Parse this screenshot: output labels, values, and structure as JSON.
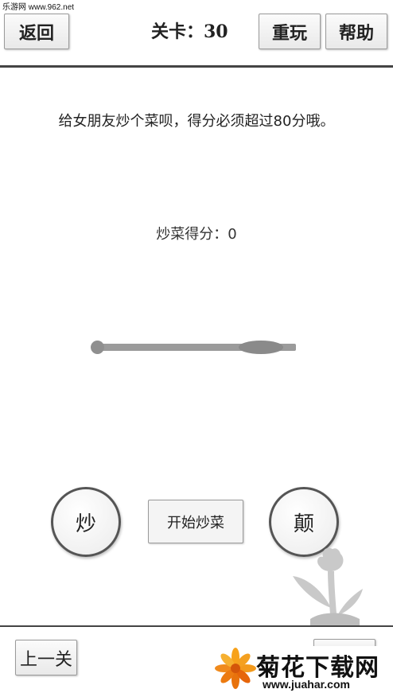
{
  "watermark": {
    "site_text": "乐游网 www.962.net"
  },
  "header": {
    "back_label": "返回",
    "level_label": "关卡：30",
    "replay_label": "重玩",
    "help_label": "帮助"
  },
  "game": {
    "instruction": "给女朋友炒个菜呗，得分必须超过80分哦。",
    "score_label": "炒菜得分：",
    "score_value": "0",
    "stir_label": "炒",
    "start_label": "开始炒菜",
    "toss_label": "颠"
  },
  "footer": {
    "prev_label": "上一关"
  },
  "logo": {
    "name": "菊花下载网",
    "url": "www.juahar.com"
  },
  "colors": {
    "divider": "#444444",
    "pan": "#9b9b9b",
    "button_bg": "#f4f4f4",
    "logo_orange": "#f08a1c"
  },
  "icons": {
    "pan": "frying-pan-icon",
    "flower": "flower-silhouette-icon",
    "logo": "chrysanthemum-logo-icon"
  }
}
